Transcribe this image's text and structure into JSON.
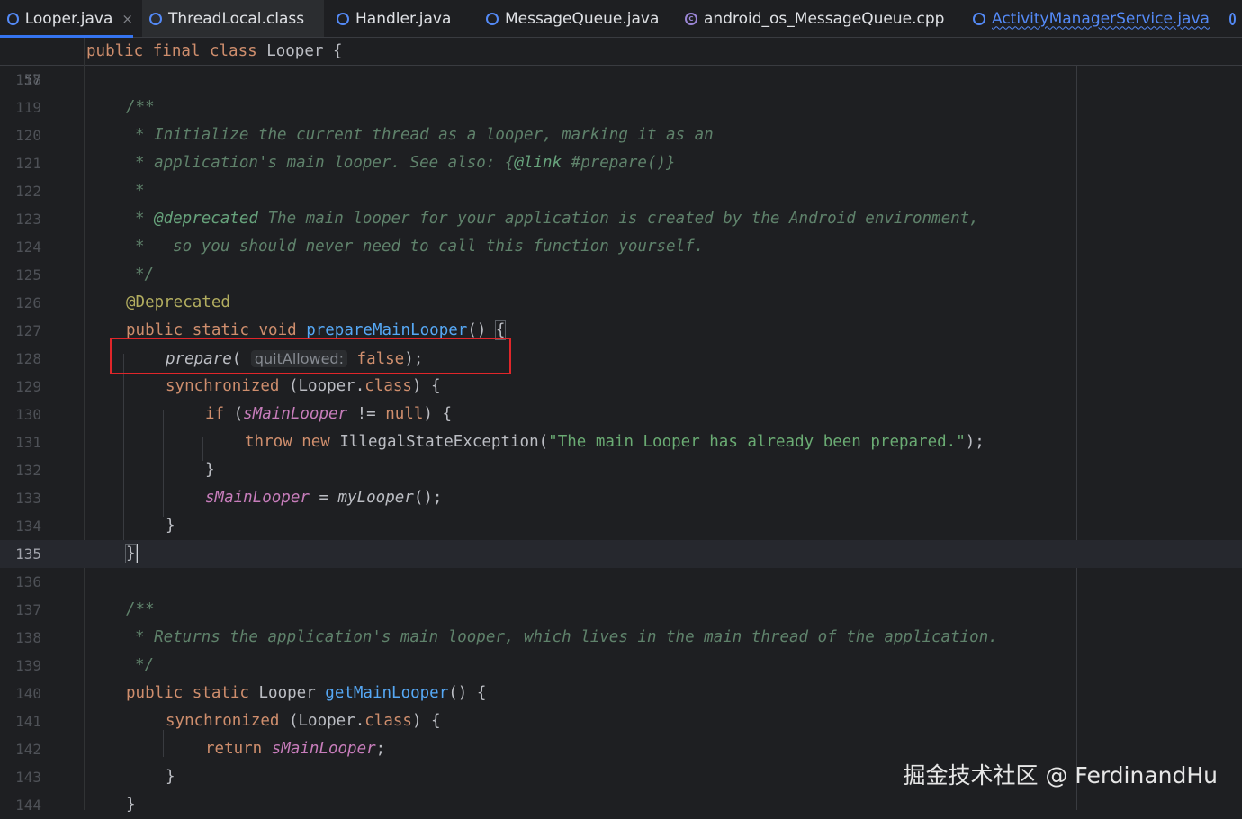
{
  "tabs": [
    {
      "label": "Looper.java",
      "icon": "java-class-icon",
      "active": true,
      "close": "×"
    },
    {
      "label": "ThreadLocal.class",
      "icon": "java-class-icon"
    },
    {
      "label": "Handler.java",
      "icon": "java-class-icon"
    },
    {
      "label": "MessageQueue.java",
      "icon": "java-class-icon"
    },
    {
      "label": "android_os_MessageQueue.cpp",
      "icon": "cpp-file-icon"
    },
    {
      "label": "ActivityManagerService.java",
      "icon": "java-class-icon"
    }
  ],
  "sticky_header": {
    "line_number": "57",
    "kw": "public final class",
    "name": "Looper",
    "brace": "{"
  },
  "lines": [
    {
      "n": "118"
    },
    {
      "n": "119",
      "t": "/**"
    },
    {
      "n": "120",
      "t": "* Initialize the current thread as a looper, marking it as an"
    },
    {
      "n": "121",
      "t": "* application's main looper. See also: {",
      "t2": "@link",
      "t3": " #prepare()}"
    },
    {
      "n": "122",
      "t": "*"
    },
    {
      "n": "123",
      "t": "* ",
      "t2": "@deprecated",
      "t3": " The main looper for your application is created by the Android environment,"
    },
    {
      "n": "124",
      "t": "*   so you should never need to call this function yourself."
    },
    {
      "n": "125",
      "t": "*/"
    },
    {
      "n": "126",
      "t": "@Deprecated"
    },
    {
      "n": "127",
      "kw": "public static void ",
      "fn": "prepareMainLooper",
      "rest": "() ",
      "brace": "{"
    },
    {
      "n": "128",
      "call": "prepare",
      "p1": "(",
      "hint": "quitAllowed:",
      "kw": "false",
      "rest": ");"
    },
    {
      "n": "129",
      "kw": "synchronized ",
      "rest": "(Looper.",
      "kw2": "class",
      "rest2": ") {"
    },
    {
      "n": "130",
      "kw": "if ",
      "rest": "(",
      "st": "sMainLooper",
      "rest2": " != ",
      "kw2": "null",
      "rest3": ") {"
    },
    {
      "n": "131",
      "kw": "throw new ",
      "rest": "IllegalStateException(",
      "str": "\"The main Looper has already been prepared.\"",
      "rest2": ");"
    },
    {
      "n": "132",
      "rest": "}"
    },
    {
      "n": "133",
      "st": "sMainLooper",
      "rest": " = ",
      "call": "myLooper",
      "rest2": "();"
    },
    {
      "n": "134",
      "rest": "}"
    },
    {
      "n": "135",
      "rest": "}"
    },
    {
      "n": "136"
    },
    {
      "n": "137",
      "t": "/**"
    },
    {
      "n": "138",
      "t": "* Returns the application's main looper, which lives in the main thread of the application."
    },
    {
      "n": "139",
      "t": "*/"
    },
    {
      "n": "140",
      "kw": "public static ",
      "rest": "Looper ",
      "fn": "getMainLooper",
      "rest2": "() {"
    },
    {
      "n": "141",
      "kw": "synchronized ",
      "rest": "(Looper.",
      "kw2": "class",
      "rest2": ") {"
    },
    {
      "n": "142",
      "kw": "return ",
      "st": "sMainLooper",
      "rest": ";"
    },
    {
      "n": "143",
      "rest": "}"
    },
    {
      "n": "144",
      "rest": "}"
    }
  ],
  "current_line": "135",
  "watermark": "掘金技术社区 @ FerdinandHu",
  "colors": {
    "accent": "#3574f0",
    "highlight_box": "#e0262a",
    "keyword": "#cf8e6d",
    "function": "#56a8f5",
    "static_field": "#c77dbb",
    "string": "#6aab73"
  }
}
